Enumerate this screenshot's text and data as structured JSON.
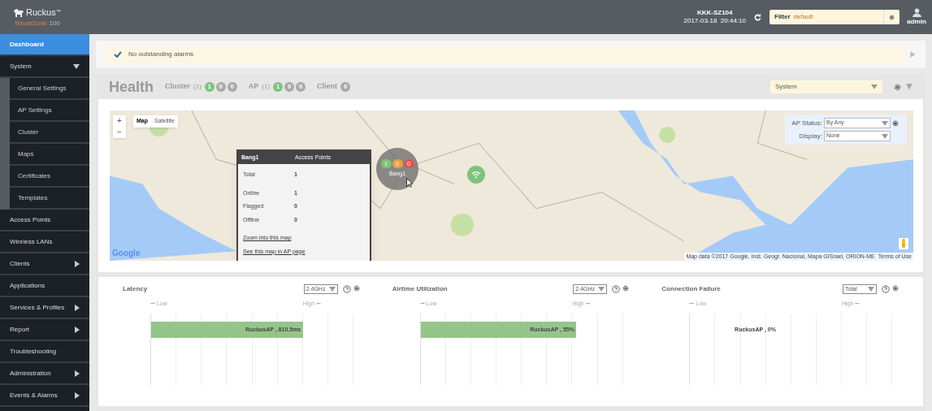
{
  "header": {
    "logo": "Ruckus",
    "logo_tm": "™",
    "product": "SmartZone",
    "product_num": "100",
    "host": "KKK-SZ104",
    "datetime": "2017-03-18  20:44:10",
    "filter_label": "Filter",
    "filter_value": "default",
    "user": "admin"
  },
  "sidebar": {
    "items": [
      {
        "label": "Dashboard",
        "selected": true,
        "kind": "link"
      },
      {
        "label": "System",
        "selected": false,
        "kind": "menu",
        "expanded": true,
        "children": [
          {
            "label": "General Settings",
            "selected": false
          },
          {
            "label": "AP Settings",
            "selected": false
          },
          {
            "label": "Cluster",
            "selected": false
          },
          {
            "label": "Maps",
            "selected": false
          },
          {
            "label": "Certificates",
            "selected": false
          },
          {
            "label": "Templates",
            "selected": false
          }
        ]
      },
      {
        "label": "Access Points",
        "selected": false,
        "kind": "link"
      },
      {
        "label": "Wireless LANs",
        "selected": false,
        "kind": "link"
      },
      {
        "label": "Clients",
        "selected": false,
        "kind": "menu",
        "expanded": false
      },
      {
        "label": "Applications",
        "selected": false,
        "kind": "link"
      },
      {
        "label": "Services & Profiles",
        "selected": false,
        "kind": "menu",
        "expanded": false
      },
      {
        "label": "Report",
        "selected": false,
        "kind": "menu",
        "expanded": false
      },
      {
        "label": "Troubleshooting",
        "selected": false,
        "kind": "link"
      },
      {
        "label": "Administration",
        "selected": false,
        "kind": "menu",
        "expanded": false
      },
      {
        "label": "Events & Alarms",
        "selected": false,
        "kind": "menu",
        "expanded": false
      }
    ]
  },
  "alarm": {
    "text": "No outstanding alarms"
  },
  "health": {
    "title": "Health",
    "groups": [
      {
        "label": "Cluster",
        "count": "(1)",
        "badges": [
          {
            "text": "1",
            "color": "#7dc37a"
          },
          {
            "text": "0",
            "color": "#a9a9a9"
          },
          {
            "text": "0",
            "color": "#a9a9a9"
          }
        ]
      },
      {
        "label": "AP",
        "count": "(1)",
        "badges": [
          {
            "text": "1",
            "color": "#7dc37a"
          },
          {
            "text": "0",
            "color": "#a9a9a9"
          },
          {
            "text": "0",
            "color": "#a9a9a9"
          }
        ]
      },
      {
        "label": "Client",
        "badges": [
          {
            "text": "0",
            "color": "#a9a9a9"
          }
        ]
      }
    ],
    "scope": "System"
  },
  "map": {
    "zoom_in": "+",
    "zoom_out": "−",
    "types": [
      {
        "label": "Map",
        "selected": true
      },
      {
        "label": "Satellite",
        "selected": false
      }
    ],
    "marker": {
      "label": "Bang1",
      "counts": [
        {
          "text": "1",
          "color": "#7dc37a"
        },
        {
          "text": "0",
          "color": "#e8a040"
        },
        {
          "text": "0",
          "color": "#e05555"
        }
      ]
    },
    "popup": {
      "name": "Bang1",
      "heading": "Access Points",
      "rows": [
        {
          "label": "Total",
          "value": "1"
        },
        {
          "label": "Online",
          "value": "1"
        },
        {
          "label": "Flagged",
          "value": "0"
        },
        {
          "label": "Offline",
          "value": "0"
        }
      ],
      "links": [
        "Zoom into this map",
        "See this map in AP page"
      ]
    },
    "ap_status_label": "AP Status:",
    "ap_status": "By Any",
    "display_label": "Display:",
    "display": "None",
    "google": "Google",
    "attribution": "Map data ©2017 Google, Inst. Geogr. Nacional, Mapa GISrael, ORION-ME",
    "terms": "Terms of Use"
  },
  "charts": [
    {
      "title": "Latency",
      "select": "2.4GHz",
      "low": "⇀ Low",
      "high": "High ↽",
      "bar_label": "RuckusAP , 810.5ms",
      "level": 0.75
    },
    {
      "title": "Airtime Utilization",
      "select": "2.4GHz",
      "low": "⇀ Low",
      "high": "High ↽",
      "bar_label": "RuckusAP , 55%",
      "level": 0.77
    },
    {
      "title": "Connection Failure",
      "select": "Total",
      "low": "⇀ Low",
      "high": "High ↽",
      "bar_label": "RuckusAP , 0%",
      "level": 0
    }
  ]
}
